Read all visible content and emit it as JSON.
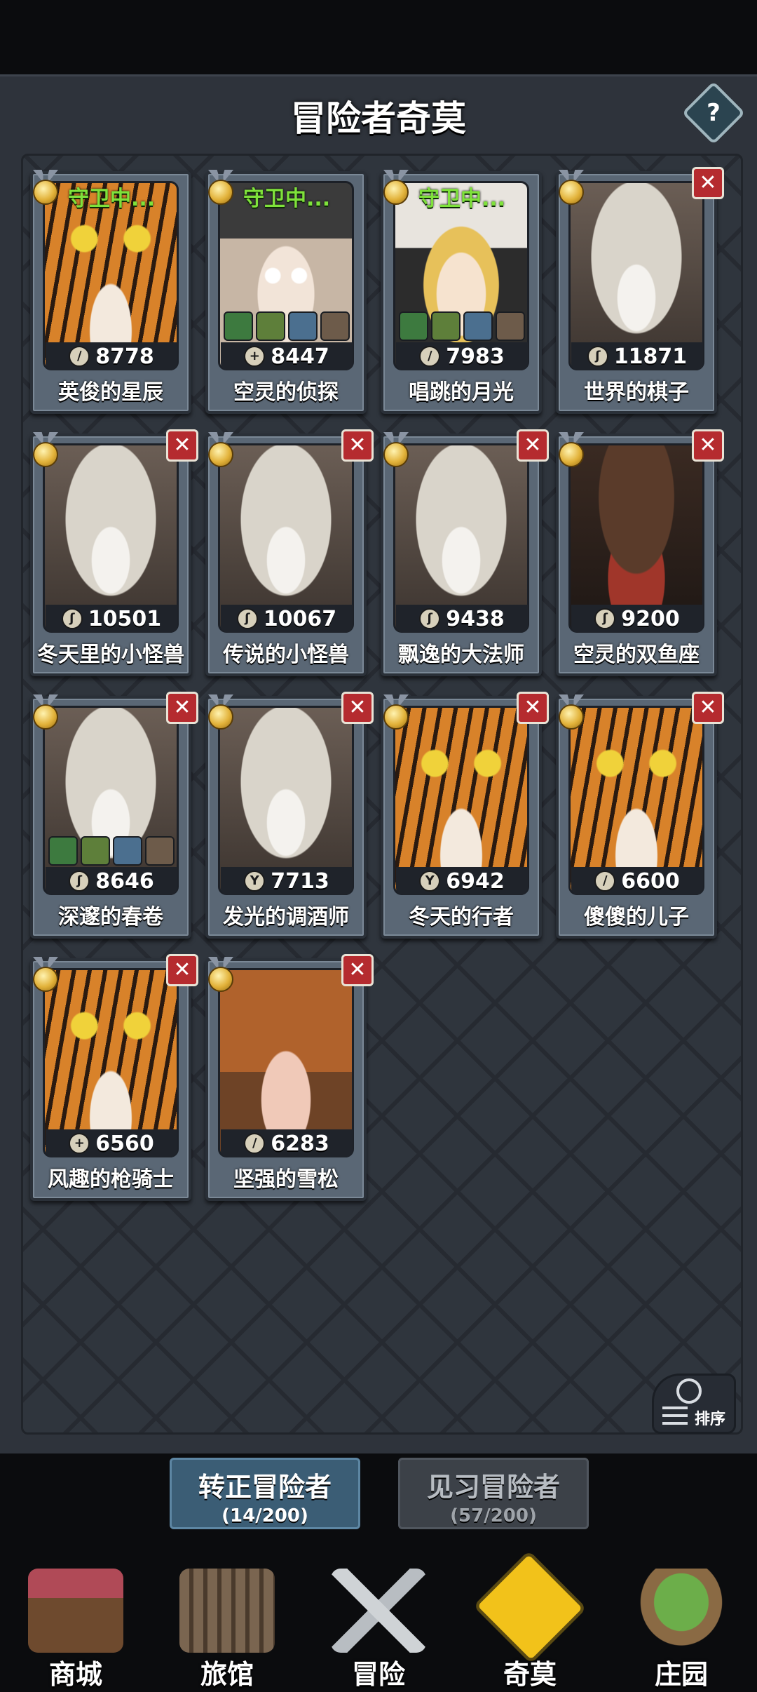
{
  "header": {
    "title": "冒险者奇莫",
    "help_label": "?"
  },
  "status": {
    "guarding": "守卫中..."
  },
  "cards": [
    {
      "name": "英俊的星辰",
      "power": "8778",
      "class_icon": "dagger-icon",
      "guarding": true,
      "removable": false,
      "art": "tiger"
    },
    {
      "name": "空灵的侦探",
      "power": "8447",
      "class_icon": "crosshair-icon",
      "guarding": true,
      "removable": false,
      "art": "hood",
      "equipment": [
        "bag-icon",
        "ring-icon",
        "herb-icon",
        "sword-icon"
      ]
    },
    {
      "name": "唱跳的月光",
      "power": "7983",
      "class_icon": "dagger-icon",
      "guarding": true,
      "removable": false,
      "art": "panda",
      "equipment": [
        "shield-icon",
        "staff-icon",
        "armor-icon",
        "glove-icon"
      ]
    },
    {
      "name": "世界的棋子",
      "power": "11871",
      "class_icon": "claw-icon",
      "guarding": false,
      "removable": true,
      "art": "skull"
    },
    {
      "name": "冬天里的小怪兽",
      "power": "10501",
      "class_icon": "claw-icon",
      "guarding": false,
      "removable": true,
      "art": "skull"
    },
    {
      "name": "传说的小怪兽",
      "power": "10067",
      "class_icon": "claw-icon",
      "guarding": false,
      "removable": true,
      "art": "skull"
    },
    {
      "name": "飘逸的大法师",
      "power": "9438",
      "class_icon": "claw-icon",
      "guarding": false,
      "removable": true,
      "art": "skull"
    },
    {
      "name": "空灵的双鱼座",
      "power": "9200",
      "class_icon": "claw-icon",
      "guarding": false,
      "removable": true,
      "art": "cowboy"
    },
    {
      "name": "深邃的春卷",
      "power": "8646",
      "class_icon": "claw-icon",
      "guarding": false,
      "removable": true,
      "art": "skull",
      "equipment": [
        "glove-icon",
        "bag-icon",
        "armor-icon",
        "claw-icon"
      ]
    },
    {
      "name": "发光的调酒师",
      "power": "7713",
      "class_icon": "wrench-icon",
      "guarding": false,
      "removable": true,
      "art": "skull"
    },
    {
      "name": "冬天的行者",
      "power": "6942",
      "class_icon": "wrench-icon",
      "guarding": false,
      "removable": true,
      "art": "tiger"
    },
    {
      "name": "傻傻的儿子",
      "power": "6600",
      "class_icon": "dagger-icon",
      "guarding": false,
      "removable": true,
      "art": "tiger"
    },
    {
      "name": "风趣的枪骑士",
      "power": "6560",
      "class_icon": "crosshair-icon",
      "guarding": false,
      "removable": true,
      "art": "tiger"
    },
    {
      "name": "坚强的雪松",
      "power": "6283",
      "class_icon": "dagger-icon",
      "guarding": false,
      "removable": true,
      "art": "pumpkin"
    }
  ],
  "sort": {
    "label": "排序"
  },
  "tabs": [
    {
      "label": "转正冒险者",
      "count": "(14/200)",
      "active": true
    },
    {
      "label": "见习冒险者",
      "count": "(57/200)",
      "active": false
    }
  ],
  "nav": [
    {
      "label": "商城",
      "icon": "shop-icon",
      "active": false
    },
    {
      "label": "旅馆",
      "icon": "gate-icon",
      "active": false
    },
    {
      "label": "冒险",
      "icon": "crossed-swords-icon",
      "active": false
    },
    {
      "label": "奇莫",
      "icon": "chimo-face-icon",
      "active": true
    },
    {
      "label": "庄园",
      "icon": "island-icon",
      "active": false
    }
  ],
  "colors": {
    "panel_bg": "#2e333b",
    "guard_green": "#7fe23b",
    "remove_red": "#b52b2f",
    "active_tab": "#3b5d75",
    "nav_active": "#f2c21a"
  }
}
